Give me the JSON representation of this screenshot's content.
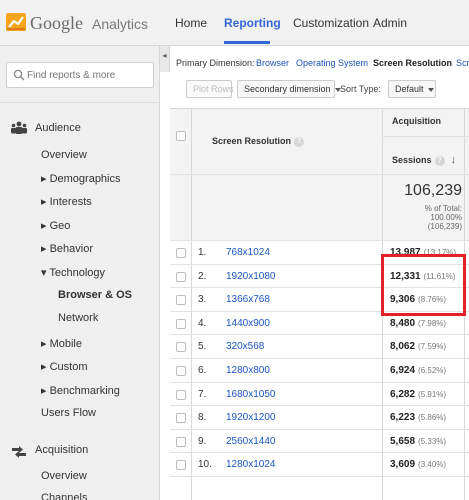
{
  "app": {
    "logo_google": "Google",
    "logo_analytics": "Analytics"
  },
  "topnav": [
    {
      "label": "Home",
      "active": false
    },
    {
      "label": "Reporting",
      "active": true
    },
    {
      "label": "Customization",
      "active": false
    },
    {
      "label": "Admin",
      "active": false
    }
  ],
  "sidebar": {
    "toggle_glyph": "◂",
    "search_placeholder": "Find reports & more",
    "sections": {
      "audience": "Audience",
      "acquisition": "Acquisition"
    },
    "items": {
      "overview": "Overview",
      "demographics": "▸ Demographics",
      "interests": "▸ Interests",
      "geo": "▸ Geo",
      "behavior": "▸ Behavior",
      "technology": "▾ Technology",
      "browser_os": "Browser & OS",
      "network": "Network",
      "mobile": "▸ Mobile",
      "custom": "▸ Custom",
      "benchmarking": "▸ Benchmarking",
      "users_flow": "Users Flow",
      "acq_overview": "Overview",
      "channels": "Channels"
    }
  },
  "dimension_bar": {
    "label": "Primary Dimension:",
    "browser": "Browser",
    "os": "Operating System",
    "screen_resolution": "Screen Resolution",
    "more": "Scr"
  },
  "toolbar": {
    "plot_rows": "Plot Rows",
    "secondary_dimension": "Secondary dimension",
    "sort_type_label": "Sort Type:",
    "sort_type_value": "Default"
  },
  "table": {
    "group_header": "Acquisition",
    "dim_header": "Screen Resolution",
    "metric_header": "Sessions",
    "help_glyph": "?",
    "sort_glyph": "↓",
    "total": {
      "value": "106,239",
      "line1": "% of Total:",
      "line2": "100.00%",
      "line3": "(106,239)"
    },
    "rows": [
      {
        "num": "1.",
        "res": "768x1024",
        "val": "13,987",
        "pct": "(13.17%)"
      },
      {
        "num": "2.",
        "res": "1920x1080",
        "val": "12,331",
        "pct": "(11.61%)"
      },
      {
        "num": "3.",
        "res": "1366x768",
        "val": "9,306",
        "pct": "(8.76%)"
      },
      {
        "num": "4.",
        "res": "1440x900",
        "val": "8,480",
        "pct": "(7.98%)"
      },
      {
        "num": "5.",
        "res": "320x568",
        "val": "8,062",
        "pct": "(7.59%)"
      },
      {
        "num": "6.",
        "res": "1280x800",
        "val": "6,924",
        "pct": "(6.52%)"
      },
      {
        "num": "7.",
        "res": "1680x1050",
        "val": "6,282",
        "pct": "(5.91%)"
      },
      {
        "num": "8.",
        "res": "1920x1200",
        "val": "6,223",
        "pct": "(5.86%)"
      },
      {
        "num": "9.",
        "res": "2560x1440",
        "val": "5,658",
        "pct": "(5.33%)"
      },
      {
        "num": "10.",
        "res": "1280x1024",
        "val": "3,609",
        "pct": "(3.40%)"
      }
    ]
  },
  "colors": {
    "accent": "#3367d6",
    "link": "#1a55c0",
    "highlight": "#e5202a"
  }
}
